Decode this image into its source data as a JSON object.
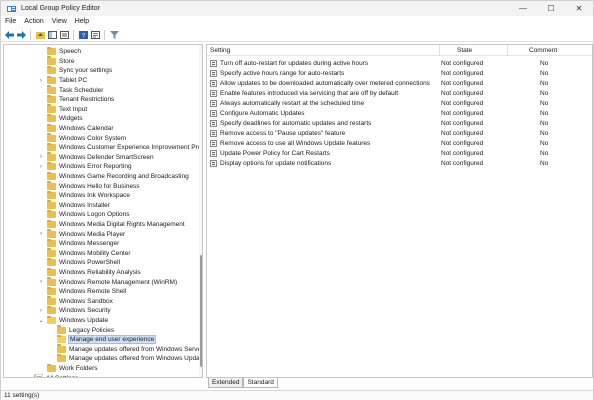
{
  "window": {
    "title": "Local Group Policy Editor"
  },
  "menu": [
    "File",
    "Action",
    "View",
    "Help"
  ],
  "window_controls": {
    "minimize": "—",
    "maximize": "☐",
    "close": "✕"
  },
  "toolbar": {
    "back_icon": "back-arrow-icon",
    "forward_icon": "forward-arrow-icon",
    "folder_up_icon": "folder-up-icon",
    "show_hide_tree_icon": "show-hide-tree-icon",
    "export_list_icon": "export-list-icon",
    "help_icon": "help-icon",
    "properties_icon": "properties-icon",
    "filter_icon": "filter-icon"
  },
  "tree": [
    {
      "label": "Speech",
      "expander": ""
    },
    {
      "label": "Store",
      "expander": ""
    },
    {
      "label": "Sync your settings",
      "expander": ""
    },
    {
      "label": "Tablet PC",
      "expander": "›"
    },
    {
      "label": "Task Scheduler",
      "expander": ""
    },
    {
      "label": "Tenant Restrictions",
      "expander": ""
    },
    {
      "label": "Text Input",
      "expander": ""
    },
    {
      "label": "Widgets",
      "expander": ""
    },
    {
      "label": "Windows Calendar",
      "expander": ""
    },
    {
      "label": "Windows Color System",
      "expander": ""
    },
    {
      "label": "Windows Customer Experience Improvement Prog",
      "expander": ""
    },
    {
      "label": "Windows Defender SmartScreen",
      "expander": "›"
    },
    {
      "label": "Windows Error Reporting",
      "expander": "›"
    },
    {
      "label": "Windows Game Recording and Broadcasting",
      "expander": ""
    },
    {
      "label": "Windows Hello for Business",
      "expander": ""
    },
    {
      "label": "Windows Ink Workspace",
      "expander": ""
    },
    {
      "label": "Windows Installer",
      "expander": ""
    },
    {
      "label": "Windows Logon Options",
      "expander": ""
    },
    {
      "label": "Windows Media Digital Rights Management",
      "expander": ""
    },
    {
      "label": "Windows Media Player",
      "expander": "›"
    },
    {
      "label": "Windows Messenger",
      "expander": ""
    },
    {
      "label": "Windows Mobility Center",
      "expander": ""
    },
    {
      "label": "Windows PowerShell",
      "expander": ""
    },
    {
      "label": "Windows Reliability Analysis",
      "expander": ""
    },
    {
      "label": "Windows Remote Management (WinRM)",
      "expander": "›"
    },
    {
      "label": "Windows Remote Shell",
      "expander": ""
    },
    {
      "label": "Windows Sandbox",
      "expander": ""
    },
    {
      "label": "Windows Security",
      "expander": "›"
    },
    {
      "label": "Windows Update",
      "expander": "⌄"
    },
    {
      "label": "Legacy Policies",
      "expander": ""
    },
    {
      "label": "Manage end user experience",
      "expander": ""
    },
    {
      "label": "Manage updates offered from Windows Server",
      "expander": ""
    },
    {
      "label": "Manage updates offered from Windows Updat",
      "expander": ""
    },
    {
      "label": "Work Folders",
      "expander": ""
    },
    {
      "label": "All Settings",
      "expander": ""
    }
  ],
  "list": {
    "headers": {
      "setting": "Setting",
      "state": "State",
      "comment": "Comment"
    },
    "rows": [
      {
        "name": "Turn off auto-restart for updates during active hours",
        "state": "Not configured",
        "comment": "No"
      },
      {
        "name": "Specify active hours range for auto-restarts",
        "state": "Not configured",
        "comment": "No"
      },
      {
        "name": "Allow updates to be downloaded automatically over metered connections",
        "state": "Not configured",
        "comment": "No"
      },
      {
        "name": "Enable features introduced via servicing that are off by default",
        "state": "Not configured",
        "comment": "No"
      },
      {
        "name": "Always automatically restart at the scheduled time",
        "state": "Not configured",
        "comment": "No"
      },
      {
        "name": "Configure Automatic Updates",
        "state": "Not configured",
        "comment": "No"
      },
      {
        "name": "Specify deadlines for automatic updates and restarts",
        "state": "Not configured",
        "comment": "No"
      },
      {
        "name": "Remove access to \"Pause updates\" feature",
        "state": "Not configured",
        "comment": "No"
      },
      {
        "name": "Remove access to use all Windows Update features",
        "state": "Not configured",
        "comment": "No"
      },
      {
        "name": "Update Power Policy for Cart Restarts",
        "state": "Not configured",
        "comment": "No"
      },
      {
        "name": "Display options for update notifications",
        "state": "Not configured",
        "comment": "No"
      }
    ]
  },
  "tabs": [
    "Extended",
    "Standard"
  ],
  "status": {
    "text": "11 setting(s)"
  },
  "colors": {
    "folder": "#e9bf4e",
    "selection": "#cce0f5",
    "accent": "#0067c0"
  }
}
